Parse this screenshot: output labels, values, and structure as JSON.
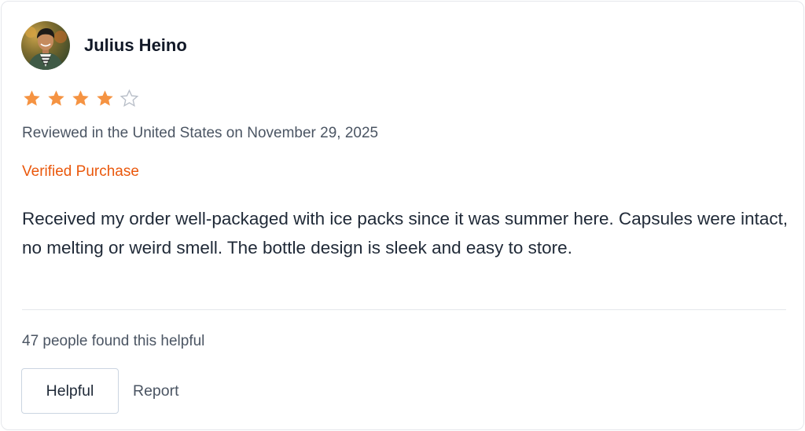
{
  "reviewer": {
    "name": "Julius Heino",
    "avatar_icon": "person-photo-avatar"
  },
  "rating": {
    "value": 4,
    "max": 5,
    "filled_color": "#f59342",
    "empty_color": "#b8bec8"
  },
  "meta": {
    "reviewed_text": "Reviewed in the United States on November 29, 2025",
    "verified_label": "Verified Purchase",
    "verified_color": "#ea580c"
  },
  "review": {
    "text": "Received my order well-packaged with ice packs since it was summer here. Capsules were intact, no melting or weird smell. The bottle design is sleek and easy to store."
  },
  "footer": {
    "helpful_count_text": "47 people found this helpful",
    "helpful_button_label": "Helpful",
    "report_button_label": "Report"
  }
}
